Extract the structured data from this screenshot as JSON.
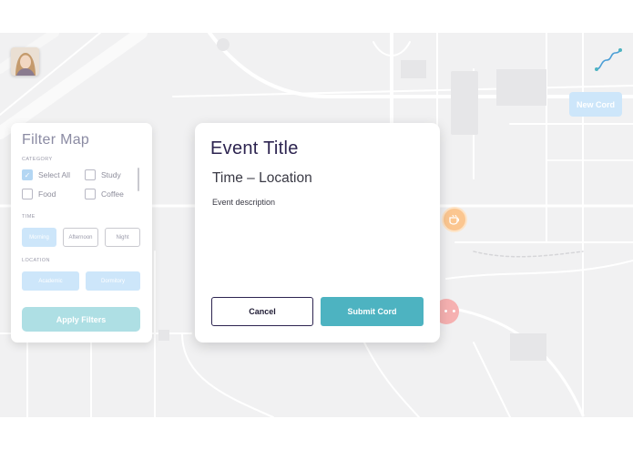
{
  "map": {
    "new_cord_label": "New Cord",
    "marker_more_label": "• • •"
  },
  "filter": {
    "title": "Filter Map",
    "category_heading": "CATEGORY",
    "categories": [
      {
        "label": "Select All",
        "checked": true
      },
      {
        "label": "Study",
        "checked": false
      },
      {
        "label": "Food",
        "checked": false
      },
      {
        "label": "Coffee",
        "checked": false
      }
    ],
    "time_heading": "TIME",
    "times": [
      {
        "label": "Morning",
        "selected": true
      },
      {
        "label": "Afternoon",
        "selected": false
      },
      {
        "label": "Night",
        "selected": false
      }
    ],
    "location_heading": "LOCATION",
    "locations": [
      {
        "label": "Academic",
        "selected": true
      },
      {
        "label": "Dormitory",
        "selected": true
      }
    ],
    "apply_label": "Apply Filters"
  },
  "event": {
    "title": "Event Title",
    "subtitle": "Time – Location",
    "description": "Event description",
    "cancel_label": "Cancel",
    "submit_label": "Submit Cord"
  },
  "colors": {
    "accent_teal": "#4db3c1",
    "title_navy": "#2d2450",
    "light_blue": "#cde6fa",
    "marker_orange": "#fbc690",
    "marker_red": "#f6b1b1",
    "map_bg": "#f1f1f2"
  },
  "icons": {
    "avatar": "user-avatar",
    "route": "route-squiggle-icon",
    "orange_marker": "coffee-cup-icon",
    "red_marker": "more-dots-icon"
  }
}
